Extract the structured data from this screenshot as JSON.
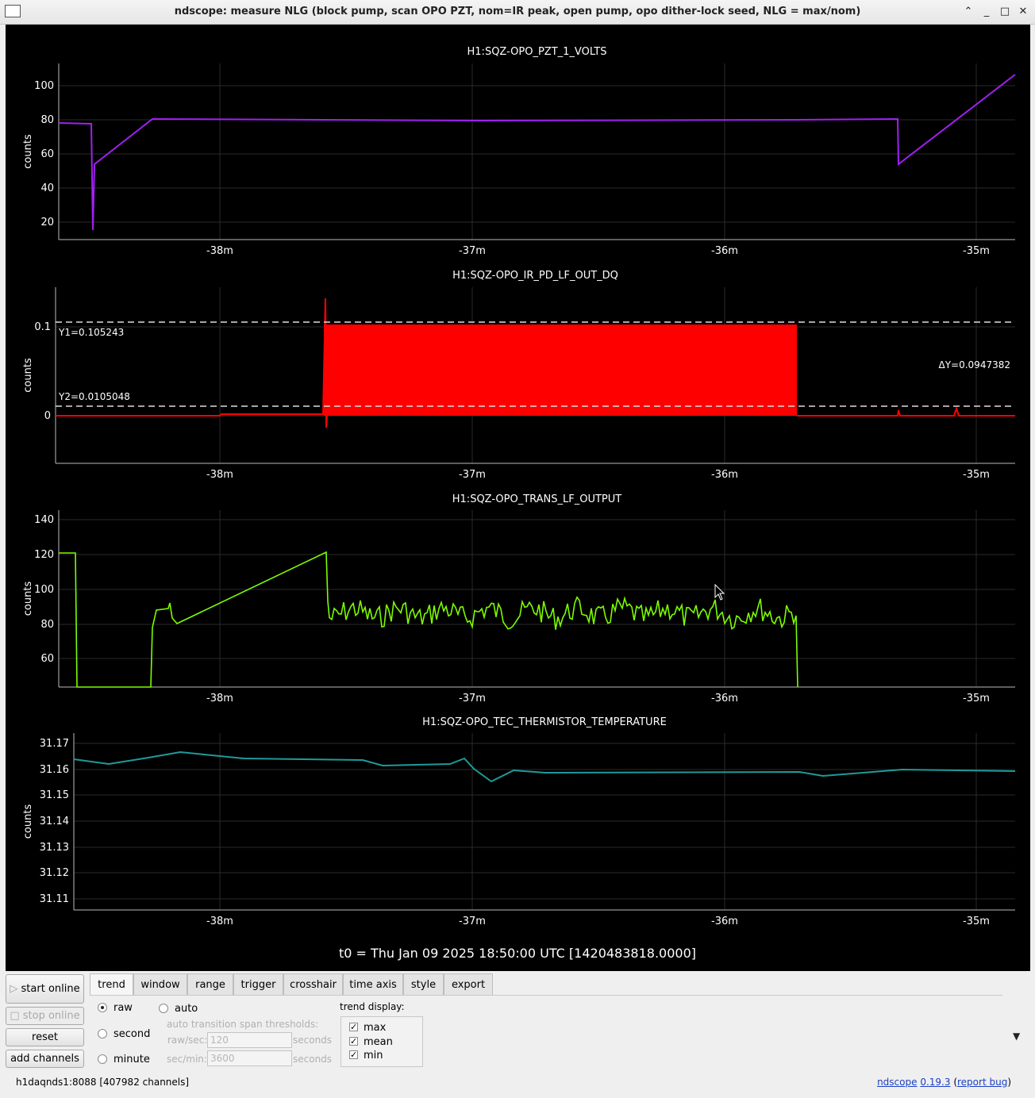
{
  "window": {
    "title": "ndscope: measure NLG (block pump, scan OPO PZT, nom=IR peak, open pump, opo dither-lock seed, NLG = max/nom)"
  },
  "plots": [
    {
      "channel": "H1:SQZ-OPO_PZT_1_VOLTS",
      "ylabel": "counts",
      "yticks": [
        "100",
        "80",
        "60",
        "40",
        "20"
      ],
      "xticks": [
        "-38m",
        "-37m",
        "-36m",
        "-35m"
      ],
      "color": "#a020f0"
    },
    {
      "channel": "H1:SQZ-OPO_IR_PD_LF_OUT_DQ",
      "ylabel": "counts",
      "yticks": [
        "0.1",
        "0"
      ],
      "xticks": [
        "-38m",
        "-37m",
        "-36m",
        "-35m"
      ],
      "color": "#ff0000",
      "crosshair": {
        "y1": "Y1=0.105243",
        "y2": "Y2=0.0105048",
        "dy": "ΔY=0.0947382"
      }
    },
    {
      "channel": "H1:SQZ-OPO_TRANS_LF_OUTPUT",
      "ylabel": "counts",
      "yticks": [
        "140",
        "120",
        "100",
        "80",
        "60"
      ],
      "xticks": [
        "-38m",
        "-37m",
        "-36m",
        "-35m"
      ],
      "color": "#7cfc00"
    },
    {
      "channel": "H1:SQZ-OPO_TEC_THERMISTOR_TEMPERATURE",
      "ylabel": "counts",
      "yticks": [
        "31.17",
        "31.16",
        "31.15",
        "31.14",
        "31.13",
        "31.12",
        "31.11"
      ],
      "xticks": [
        "-38m",
        "-37m",
        "-36m",
        "-35m"
      ],
      "color": "#1f9a9a"
    }
  ],
  "t0_label": "t0 = Thu Jan 09 2025 18:50:00 UTC [1420483818.0000]",
  "buttons": {
    "start_online": "start online",
    "stop_online": "stop online",
    "reset": "reset",
    "add_channels": "add channels"
  },
  "tabs": [
    "trend",
    "window",
    "range",
    "trigger",
    "crosshair",
    "time axis",
    "style",
    "export"
  ],
  "trend": {
    "raw": "raw",
    "auto": "auto",
    "second": "second",
    "minute": "minute",
    "thresholds_label": "auto transition span thresholds:",
    "raw_sec_label": "raw/sec:",
    "raw_sec_value": "120",
    "sec_min_label": "sec/min:",
    "sec_min_value": "3600",
    "seconds": "seconds",
    "display_label": "trend display:",
    "display_max": "max",
    "display_mean": "mean",
    "display_min": "min"
  },
  "status": {
    "server": "h1daqnds1:8088  [407982 channels]",
    "app": "ndscope",
    "version": "0.19.3",
    "report": "report bug"
  }
}
